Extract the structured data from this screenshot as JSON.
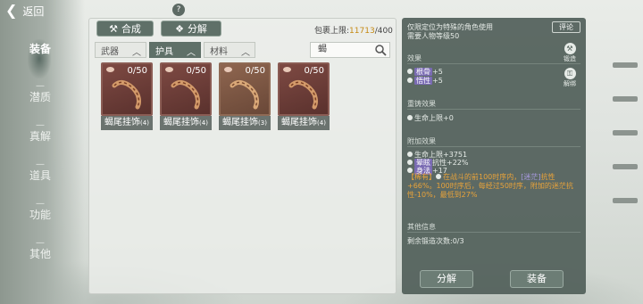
{
  "header": {
    "back_label": "返回",
    "help_label": "?"
  },
  "nav": {
    "items": [
      {
        "key": "equipment",
        "label": "装备",
        "active": true
      },
      {
        "key": "insight",
        "label": "潜质",
        "active": false
      },
      {
        "key": "true_solution",
        "label": "真解",
        "active": false
      },
      {
        "key": "items",
        "label": "道具",
        "active": false
      },
      {
        "key": "skill",
        "label": "功能",
        "active": false
      },
      {
        "key": "other",
        "label": "其他",
        "active": false
      }
    ]
  },
  "inventory": {
    "actions": {
      "combine": "合成",
      "disassemble": "分解"
    },
    "capacity_label": "包裹上限:",
    "capacity_current": "11713",
    "capacity_max": "/400",
    "filters": [
      {
        "label": "武器",
        "active": false
      },
      {
        "label": "护具",
        "active": true
      },
      {
        "label": "材料",
        "active": false
      }
    ],
    "search": {
      "value": "蝎"
    },
    "items": [
      {
        "name": "蝎尾挂饰",
        "tier": "(4)",
        "count": "0/50",
        "frame": "dark"
      },
      {
        "name": "蝎尾挂饰",
        "tier": "(4)",
        "count": "0/50",
        "frame": "dark"
      },
      {
        "name": "蝎尾挂饰",
        "tier": "(3)",
        "count": "0/50",
        "frame": "tan"
      },
      {
        "name": "蝎尾挂饰",
        "tier": "(4)",
        "count": "0/50",
        "frame": "dark"
      }
    ]
  },
  "detail": {
    "desc_line1": "仅限定位为特殊的角色使用",
    "desc_line2": "需要人物等级50",
    "comment_label": "评论",
    "side_actions": {
      "forge": "锻造",
      "unbind": "解绑"
    },
    "effect_title": "效果",
    "effects": [
      {
        "tag": "根骨",
        "value": "+5"
      },
      {
        "tag": "悟性",
        "value": "+5"
      }
    ],
    "recast_title": "重铸效果",
    "recast_value": "生命上限+0",
    "extra_title": "附加效果",
    "extra_hp": "生命上限+3751",
    "extra_stat1_tag": "晕眩",
    "extra_stat1_value": "抗性+22%",
    "extra_stat2_tag": "身法",
    "extra_stat2_value": "+17",
    "rare_prefix": "【稀有】",
    "rare_text1": "在战斗的前100时序内，",
    "rare_tag": "[迷茫]",
    "rare_text2": "抗性+66%。100时序后，每经过50时序，附加的迷茫抗性-10%，最低到27%",
    "other_title": "其他信息",
    "remaining": "剩余锻造次数:0/3",
    "btn_disassemble": "分解",
    "btn_equip": "装备"
  }
}
